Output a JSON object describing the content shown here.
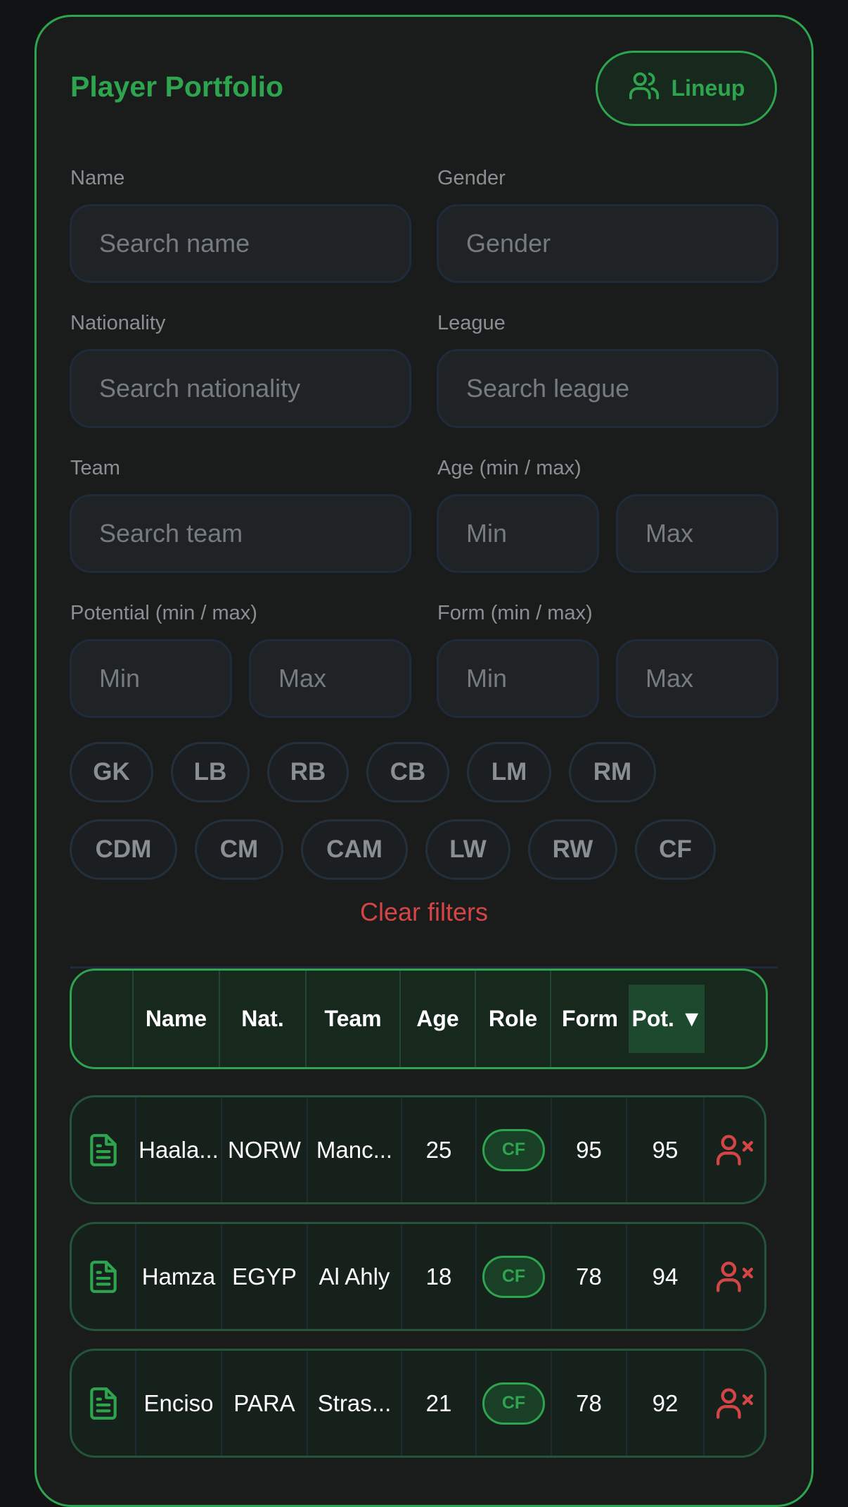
{
  "header": {
    "title": "Player Portfolio",
    "lineup_label": "Lineup"
  },
  "filters": {
    "name": {
      "label": "Name",
      "placeholder": "Search name"
    },
    "gender": {
      "label": "Gender",
      "placeholder": "Gender"
    },
    "nationality": {
      "label": "Nationality",
      "placeholder": "Search nationality"
    },
    "league": {
      "label": "League",
      "placeholder": "Search league"
    },
    "team": {
      "label": "Team",
      "placeholder": "Search team"
    },
    "age": {
      "label": "Age (min / max)",
      "min_placeholder": "Min",
      "max_placeholder": "Max"
    },
    "potential": {
      "label": "Potential (min / max)",
      "min_placeholder": "Min",
      "max_placeholder": "Max"
    },
    "form": {
      "label": "Form (min / max)",
      "min_placeholder": "Min",
      "max_placeholder": "Max"
    },
    "positions": [
      "GK",
      "LB",
      "RB",
      "CB",
      "LM",
      "RM",
      "CDM",
      "CM",
      "CAM",
      "LW",
      "RW",
      "CF"
    ],
    "clear_label": "Clear filters"
  },
  "table": {
    "headers": [
      "Name",
      "Nat.",
      "Team",
      "Age",
      "Role",
      "Form",
      "Pot. ▼"
    ],
    "rows": [
      {
        "name": "Haala...",
        "nat": "NORW",
        "team": "Manc...",
        "age": "25",
        "role": "CF",
        "form": "95",
        "pot": "95"
      },
      {
        "name": "Hamza",
        "nat": "EGYP",
        "team": "Al Ahly",
        "age": "18",
        "role": "CF",
        "form": "78",
        "pot": "94"
      },
      {
        "name": "Enciso",
        "nat": "PARA",
        "team": "Stras...",
        "age": "21",
        "role": "CF",
        "form": "78",
        "pot": "92"
      }
    ]
  },
  "colors": {
    "accent": "#2ea44f",
    "danger": "#d64545",
    "background": "#1a1c1c"
  }
}
